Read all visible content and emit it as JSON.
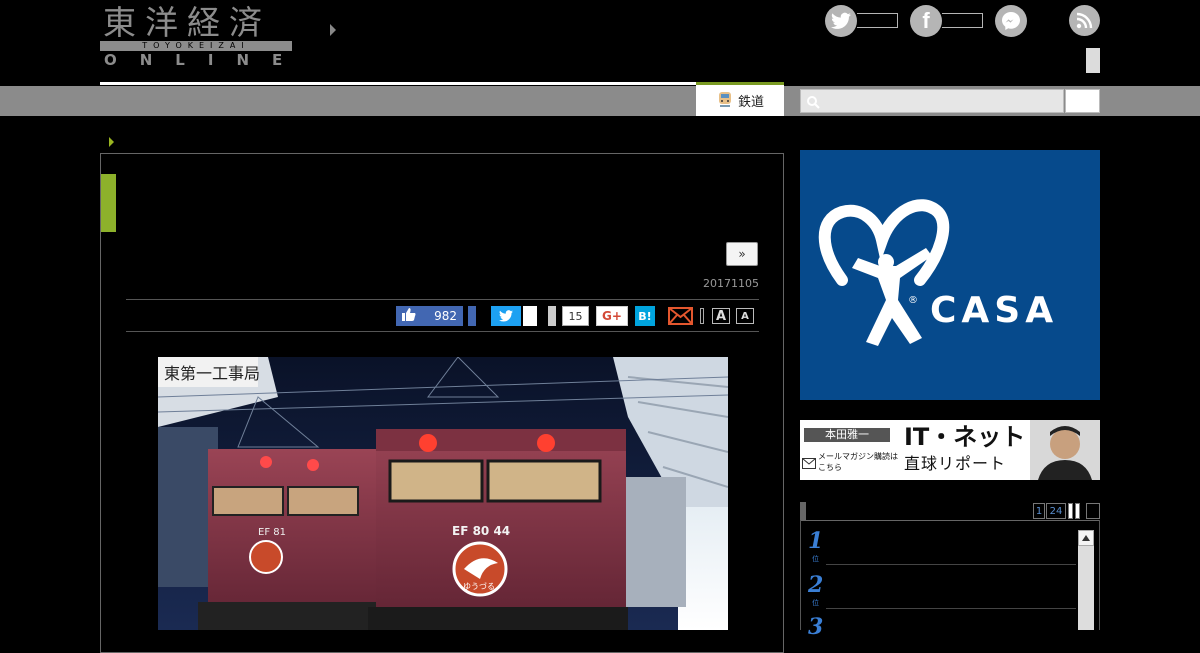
{
  "header": {
    "logo_jp": "東洋経済",
    "logo_romaji": "TOYOKEIZAI",
    "logo_online": "ONLINE",
    "social_icons": [
      "twitter-icon",
      "facebook-icon",
      "messenger-icon",
      "rss-icon"
    ]
  },
  "nav": {
    "category_label": "鉄道",
    "search_placeholder": ""
  },
  "article": {
    "next_label": "»",
    "date": "20171105",
    "share": {
      "facebook_count": "982",
      "hatena_count": "15",
      "gplus_label": "G+",
      "hatena_label": "B!",
      "font_large": "A",
      "font_small": "A"
    },
    "photo": {
      "sign_text": "東第一工事局",
      "loco_left_id": "EF 81",
      "loco_right_id": "EF 80 44",
      "headmark": "ゆうづる"
    }
  },
  "sidebar": {
    "ad_casa": {
      "brand": "CASA",
      "reg_mark": "®"
    },
    "ad_honda": {
      "author": "本田雅一",
      "title": "IT・ネット",
      "subtitle": "直球リポート",
      "cta": "メールマガジン購読はこちら"
    },
    "ranking": {
      "tabs": [
        "1",
        "24"
      ],
      "items": [
        {
          "rank": "1",
          "unit": "位"
        },
        {
          "rank": "2",
          "unit": "位"
        },
        {
          "rank": "3",
          "unit": ""
        }
      ]
    }
  },
  "colors": {
    "accent_green": "#8db12b",
    "casa_blue": "#064a8c",
    "nav_gray": "#8b8b8b"
  }
}
